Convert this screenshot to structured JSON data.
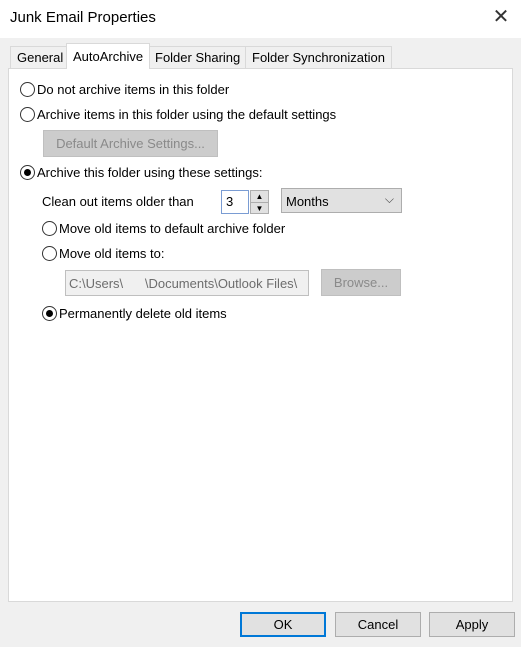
{
  "window": {
    "title": "Junk Email Properties",
    "close_icon": "close-icon"
  },
  "tabs": [
    {
      "label": "General"
    },
    {
      "label": "AutoArchive",
      "active": true
    },
    {
      "label": "Folder Sharing"
    },
    {
      "label": "Folder Synchronization"
    }
  ],
  "options": {
    "no_archive": "Do not archive items in this folder",
    "default_archive": "Archive items in this folder using the default settings",
    "default_settings_button": "Default Archive Settings...",
    "custom_archive": "Archive this folder using these settings:",
    "clean_label": "Clean out items older than",
    "clean_value": "3",
    "unit_value": "Months",
    "move_default": "Move old items to default archive folder",
    "move_to": "Move old items to:",
    "path_value": "C:\\Users\\      \\Documents\\Outlook Files\\",
    "browse_button": "Browse...",
    "delete": "Permanently delete old items",
    "selected": "custom_archive",
    "sub_selected": "delete"
  },
  "footer": {
    "ok": "OK",
    "cancel": "Cancel",
    "apply": "Apply"
  }
}
